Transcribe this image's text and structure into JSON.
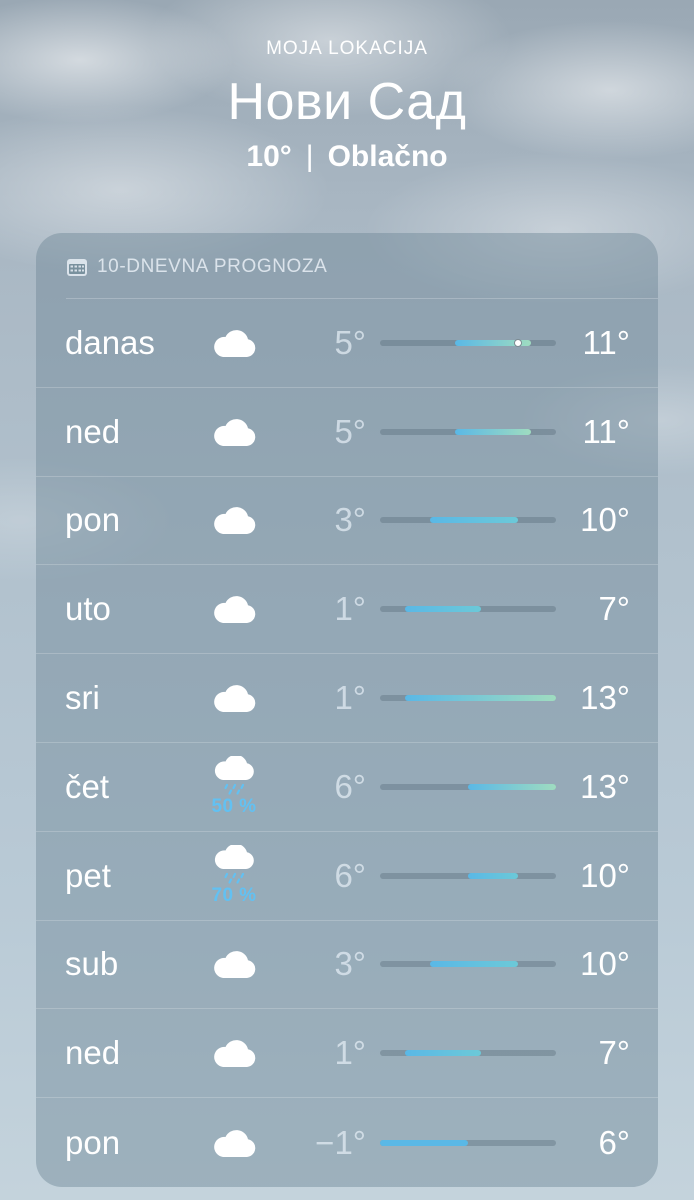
{
  "header": {
    "location_label": "MOJA LOKACIJA",
    "city": "Нови Сад",
    "current_temp": "10°",
    "separator": "|",
    "condition": "Oblačno"
  },
  "forecast": {
    "title": "10-DNEVNA PROGNOZA",
    "title_icon": "calendar-icon",
    "scale_min": -1,
    "scale_max": 13,
    "current_temp_value": 10,
    "days": [
      {
        "day": "danas",
        "icon": "cloud-icon",
        "precip": "",
        "low": "5°",
        "high": "11°",
        "low_value": 5,
        "high_value": 11,
        "current": true
      },
      {
        "day": "ned",
        "icon": "cloud-icon",
        "precip": "",
        "low": "5°",
        "high": "11°",
        "low_value": 5,
        "high_value": 11
      },
      {
        "day": "pon",
        "icon": "cloud-icon",
        "precip": "",
        "low": "3°",
        "high": "10°",
        "low_value": 3,
        "high_value": 10
      },
      {
        "day": "uto",
        "icon": "cloud-icon",
        "precip": "",
        "low": "1°",
        "high": "7°",
        "low_value": 1,
        "high_value": 7
      },
      {
        "day": "sri",
        "icon": "cloud-icon",
        "precip": "",
        "low": "1°",
        "high": "13°",
        "low_value": 1,
        "high_value": 13
      },
      {
        "day": "čet",
        "icon": "cloud-rain-icon",
        "precip": "50 %",
        "low": "6°",
        "high": "13°",
        "low_value": 6,
        "high_value": 13
      },
      {
        "day": "pet",
        "icon": "cloud-rain-icon",
        "precip": "70 %",
        "low": "6°",
        "high": "10°",
        "low_value": 6,
        "high_value": 10
      },
      {
        "day": "sub",
        "icon": "cloud-icon",
        "precip": "",
        "low": "3°",
        "high": "10°",
        "low_value": 3,
        "high_value": 10
      },
      {
        "day": "ned",
        "icon": "cloud-icon",
        "precip": "",
        "low": "1°",
        "high": "7°",
        "low_value": 1,
        "high_value": 7
      },
      {
        "day": "pon",
        "icon": "cloud-icon",
        "precip": "",
        "low": "−1°",
        "high": "6°",
        "low_value": -1,
        "high_value": 6
      }
    ]
  },
  "colors": {
    "precip_text": "#62c1f2",
    "bar_cold": "#5ab8e6",
    "bar_mild": "#6cc9d8",
    "bar_warm": "#9fdcc0"
  }
}
